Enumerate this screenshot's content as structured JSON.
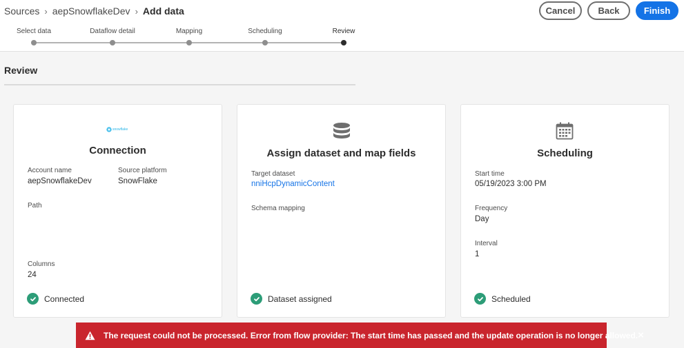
{
  "breadcrumb": {
    "items": [
      "Sources",
      "aepSnowflakeDev"
    ],
    "current": "Add data"
  },
  "actions": {
    "cancel": "Cancel",
    "back": "Back",
    "finish": "Finish"
  },
  "steps": [
    {
      "label": "Select data",
      "active": false
    },
    {
      "label": "Dataflow detail",
      "active": false
    },
    {
      "label": "Mapping",
      "active": false
    },
    {
      "label": "Scheduling",
      "active": false
    },
    {
      "label": "Review",
      "active": true
    }
  ],
  "page": {
    "section_title": "Review"
  },
  "cards": {
    "connection": {
      "logo_text": "snowflake",
      "title": "Connection",
      "account_name_label": "Account name",
      "account_name": "aepSnowflakeDev",
      "source_platform_label": "Source platform",
      "source_platform": "SnowFlake",
      "path_label": "Path",
      "columns_label": "Columns",
      "columns": "24",
      "status": "Connected"
    },
    "dataset": {
      "icon": "database-icon",
      "title": "Assign dataset and map fields",
      "target_dataset_label": "Target dataset",
      "target_dataset": "nniHcpDynamicContent",
      "schema_mapping_label": "Schema mapping",
      "status": "Dataset assigned"
    },
    "scheduling": {
      "icon": "calendar-icon",
      "title": "Scheduling",
      "start_time_label": "Start time",
      "start_time": "05/19/2023 3:00 PM",
      "frequency_label": "Frequency",
      "frequency": "Day",
      "interval_label": "Interval",
      "interval": "1",
      "status": "Scheduled"
    }
  },
  "toast": {
    "message": "The request could not be processed. Error from flow provider: The start time has passed and the update operation is no longer allowed.",
    "close": "×"
  },
  "colors": {
    "accent": "#1473e6",
    "success": "#2d9d78",
    "error": "#c9252d"
  }
}
